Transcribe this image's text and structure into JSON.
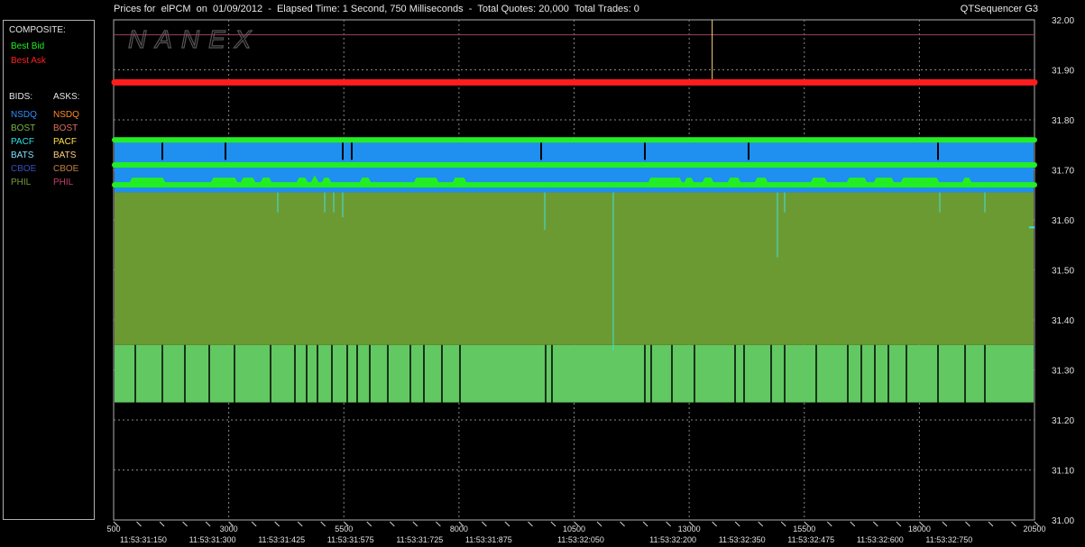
{
  "header": {
    "title": "Prices for  elPCM  on  01/09/2012  -  Elapsed Time: 1 Second, 750 Milliseconds  -  Total Quotes: 20,000  Total Trades: 0",
    "app": "QTSequencer G3",
    "watermark": "NANEX"
  },
  "legend": {
    "composite_label": "COMPOSITE:",
    "composite": [
      {
        "label": "Best Bid",
        "color": "#22ee22"
      },
      {
        "label": "Best Ask",
        "color": "#ff2020"
      }
    ],
    "bids_label": "BIDS:",
    "asks_label": "ASKS:",
    "bids": [
      {
        "label": "NSDQ",
        "color": "#2f8fff"
      },
      {
        "label": "BOST",
        "color": "#7ab648"
      },
      {
        "label": "PACF",
        "color": "#2de0e0"
      },
      {
        "label": "BATS",
        "color": "#7fe0ff"
      },
      {
        "label": "CBOE",
        "color": "#3a4fc0"
      },
      {
        "label": "PHIL",
        "color": "#7a9a3a"
      }
    ],
    "asks": [
      {
        "label": "NSDQ",
        "color": "#ff8a2a"
      },
      {
        "label": "BOST",
        "color": "#e07060"
      },
      {
        "label": "PACF",
        "color": "#ffe04a"
      },
      {
        "label": "BATS",
        "color": "#ffd080"
      },
      {
        "label": "CBOE",
        "color": "#c08040"
      },
      {
        "label": "PHIL",
        "color": "#c0406a"
      }
    ]
  },
  "chart_data": {
    "type": "area",
    "title": "",
    "xlabel": "",
    "ylabel": "",
    "ylim": [
      31.0,
      32.0
    ],
    "xlim": [
      500,
      20500
    ],
    "grid": true,
    "y_ticks": [
      "32.00",
      "31.90",
      "31.80",
      "31.70",
      "31.60",
      "31.50",
      "31.40",
      "31.30",
      "31.20",
      "31.10",
      "31.00"
    ],
    "x_ticks": [
      {
        "value": 500,
        "label": "500"
      },
      {
        "value": 3000,
        "label": "3000"
      },
      {
        "value": 5500,
        "label": "5500"
      },
      {
        "value": 8000,
        "label": "8000"
      },
      {
        "value": 10500,
        "label": "10500"
      },
      {
        "value": 13000,
        "label": "13000"
      },
      {
        "value": 15500,
        "label": "15500"
      },
      {
        "value": 18000,
        "label": "18000"
      },
      {
        "value": 20500,
        "label": "20500"
      }
    ],
    "time_labels": [
      {
        "value": 500,
        "label": "11:53:31:150"
      },
      {
        "value": 2000,
        "label": "11:53:31:300"
      },
      {
        "value": 3500,
        "label": "11:53:31:425"
      },
      {
        "value": 5000,
        "label": "11:53:31:575"
      },
      {
        "value": 6500,
        "label": "11:53:31:725"
      },
      {
        "value": 8000,
        "label": "11:53:31:875"
      },
      {
        "value": 10000,
        "label": "11:53:32:050"
      },
      {
        "value": 12000,
        "label": "11:53:32:200"
      },
      {
        "value": 13500,
        "label": "11:53:32:350"
      },
      {
        "value": 15000,
        "label": "11:53:32:475"
      },
      {
        "value": 16500,
        "label": "11:53:32:600"
      },
      {
        "value": 18000,
        "label": "11:53:32:750"
      }
    ],
    "bands": [
      {
        "name": "PHIL bid",
        "from": 31.235,
        "to": 31.35,
        "color": "#62c862"
      },
      {
        "name": "BOST bid",
        "from": 31.35,
        "to": 31.655,
        "color": "#6b9a32"
      },
      {
        "name": "NSDQ bid",
        "from": 31.655,
        "to": 31.765,
        "color": "#1f8ff0"
      }
    ],
    "series": [
      {
        "name": "Best Ask",
        "color": "#ff1c1c",
        "values": [
          31.875,
          31.875
        ]
      },
      {
        "name": "Best Bid",
        "color": "#22ee22",
        "values": [
          31.76,
          31.76
        ]
      },
      {
        "name": "Best Bid",
        "color": "#22ee22",
        "values": [
          31.71,
          31.71
        ]
      },
      {
        "name": "Best Bid",
        "color": "#22ee22",
        "values": [
          31.67,
          31.67
        ]
      }
    ],
    "ask_line": {
      "value": 31.97,
      "color": "#a04060"
    },
    "spike": {
      "x": 13500,
      "from": 31.875,
      "to": 32.0,
      "color": "#ffd080"
    },
    "right_marker": {
      "value": 31.585,
      "color": "#40e0e0"
    }
  }
}
